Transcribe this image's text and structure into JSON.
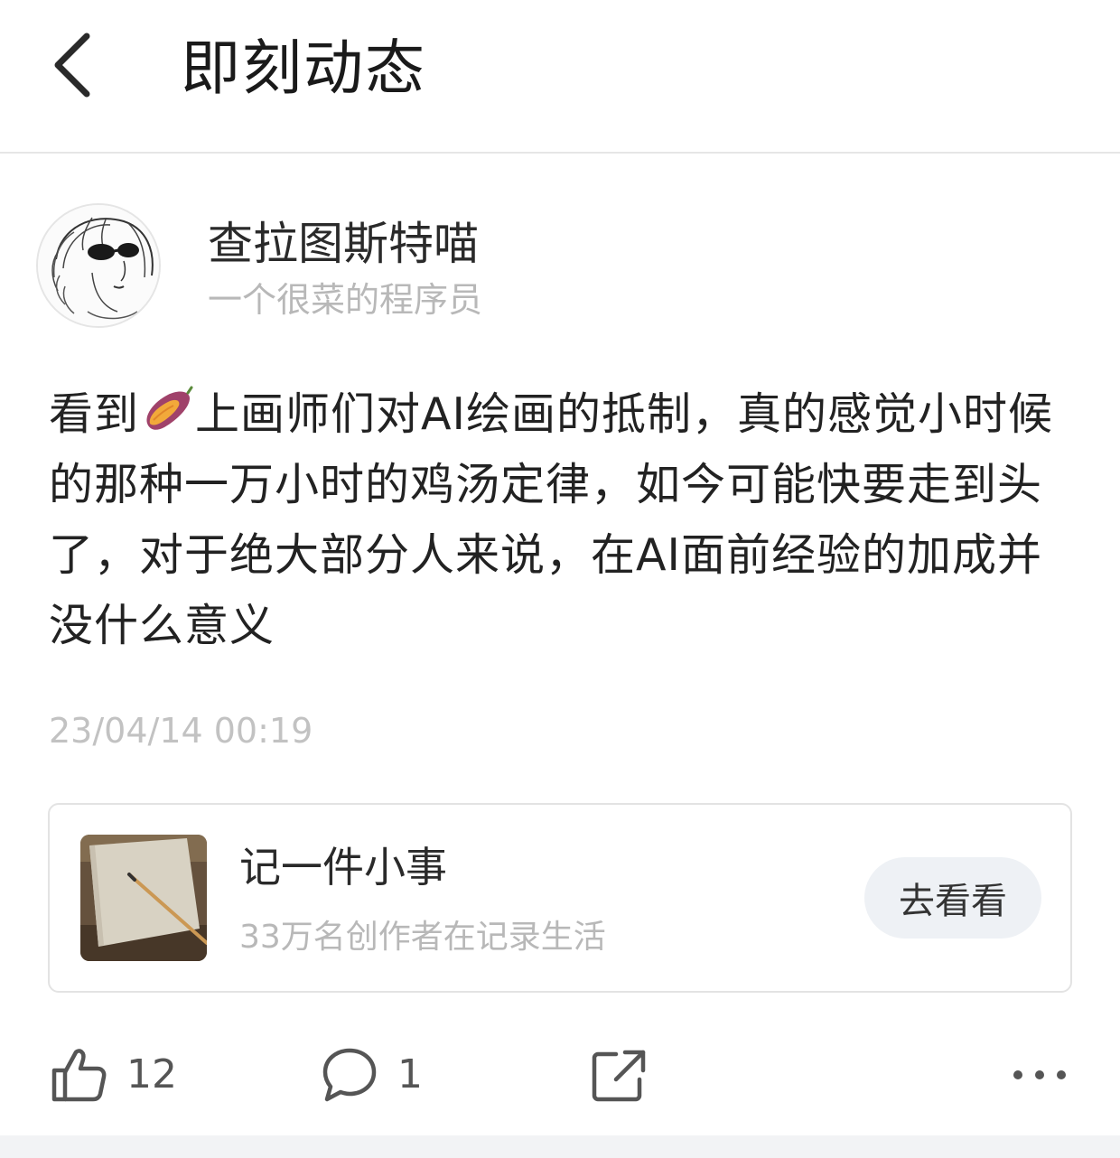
{
  "header": {
    "title": "即刻动态",
    "back_icon": "chevron-left-icon"
  },
  "author": {
    "name": "查拉图斯特喵",
    "bio": "一个很菜的程序员",
    "avatar_icon": "sketch-portrait-avatar"
  },
  "post": {
    "text_before_emoji": "看到",
    "emoji_icon": "sweet-potato-emoji",
    "text_after_emoji": "上画师们对AI绘画的抵制，真的感觉小时候的那种一万小时的鸡汤定律，如今可能快要走到头了，对于绝大部分人来说，在AI面前经验的加成并没什么意义",
    "timestamp": "23/04/14 00:19"
  },
  "topic_card": {
    "title": "记一件小事",
    "subtitle": "33万名创作者在记录生活",
    "button_label": "去看看",
    "thumbnail_icon": "notebook-pencil-thumbnail"
  },
  "actions": {
    "like_count": "12",
    "comment_count": "1",
    "like_icon": "thumbs-up-icon",
    "comment_icon": "comment-bubble-icon",
    "share_icon": "share-icon",
    "more_icon": "more-dots-icon"
  },
  "colors": {
    "text_primary": "#222222",
    "text_secondary": "#b8b8b8",
    "button_bg": "#eef1f5",
    "divider": "#e6e6e6"
  }
}
